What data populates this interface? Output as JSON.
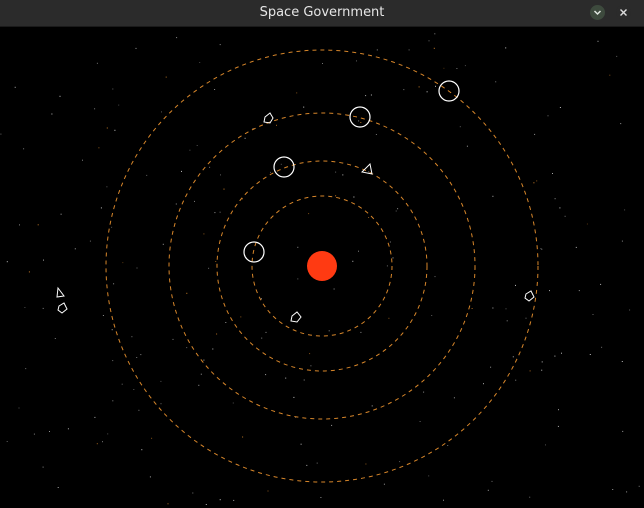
{
  "window": {
    "title": "Space Government",
    "buttons": [
      "minimize",
      "close"
    ]
  },
  "game": {
    "colors": {
      "background": "#000000",
      "orbit": "#d7862a",
      "sun": "#ff3a12",
      "planet_outline": "#ffffff",
      "star": "#cfcfcf"
    },
    "sun": {
      "label": "sun"
    },
    "orbits": [
      {
        "name": "orbit-1"
      },
      {
        "name": "orbit-2"
      },
      {
        "name": "orbit-3"
      },
      {
        "name": "orbit-4"
      }
    ],
    "planets": [
      {
        "name": "planet-inner"
      },
      {
        "name": "planet-second"
      },
      {
        "name": "planet-third"
      },
      {
        "name": "planet-outer"
      }
    ],
    "ships": [
      {
        "name": "ship-near-orbit-3",
        "kind": "triangle"
      },
      {
        "name": "ship-far-left",
        "kind": "triangle"
      }
    ],
    "asteroids": [
      {
        "name": "asteroid-upper-left"
      },
      {
        "name": "asteroid-lower-inner"
      },
      {
        "name": "asteroid-right-edge"
      },
      {
        "name": "asteroid-far-left"
      }
    ]
  }
}
